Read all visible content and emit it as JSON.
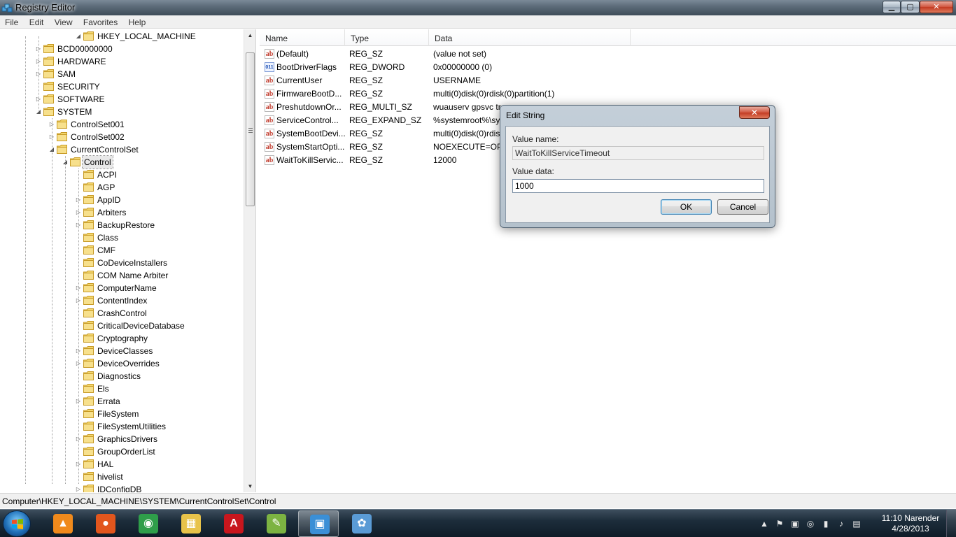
{
  "window": {
    "title": "Registry Editor"
  },
  "menu": [
    "File",
    "Edit",
    "View",
    "Favorites",
    "Help"
  ],
  "tree": {
    "items": [
      {
        "label": "HKEY_LOCAL_MACHINE",
        "expanded": true
      },
      {
        "label": "BCD00000000"
      },
      {
        "label": "HARDWARE"
      },
      {
        "label": "SAM"
      },
      {
        "label": "SECURITY"
      },
      {
        "label": "SOFTWARE"
      },
      {
        "label": "SYSTEM",
        "expanded": true
      },
      {
        "label": "ControlSet001"
      },
      {
        "label": "ControlSet002"
      },
      {
        "label": "CurrentControlSet",
        "expanded": true
      },
      {
        "label": "Control",
        "expanded": true,
        "selected": true
      },
      {
        "label": "ACPI"
      },
      {
        "label": "AGP"
      },
      {
        "label": "AppID"
      },
      {
        "label": "Arbiters"
      },
      {
        "label": "BackupRestore"
      },
      {
        "label": "Class"
      },
      {
        "label": "CMF"
      },
      {
        "label": "CoDeviceInstallers"
      },
      {
        "label": "COM Name Arbiter"
      },
      {
        "label": "ComputerName"
      },
      {
        "label": "ContentIndex"
      },
      {
        "label": "CrashControl"
      },
      {
        "label": "CriticalDeviceDatabase"
      },
      {
        "label": "Cryptography"
      },
      {
        "label": "DeviceClasses"
      },
      {
        "label": "DeviceOverrides"
      },
      {
        "label": "Diagnostics"
      },
      {
        "label": "Els"
      },
      {
        "label": "Errata"
      },
      {
        "label": "FileSystem"
      },
      {
        "label": "FileSystemUtilities"
      },
      {
        "label": "GraphicsDrivers"
      },
      {
        "label": "GroupOrderList"
      },
      {
        "label": "HAL"
      },
      {
        "label": "hivelist"
      },
      {
        "label": "IDConfigDB"
      }
    ]
  },
  "list": {
    "columns": [
      "Name",
      "Type",
      "Data"
    ],
    "rows": [
      {
        "icon": "string-value-icon",
        "name": "(Default)",
        "type": "REG_SZ",
        "data": "(value not set)"
      },
      {
        "icon": "binary-value-icon",
        "name": "BootDriverFlags",
        "type": "REG_DWORD",
        "data": "0x00000000 (0)"
      },
      {
        "icon": "string-value-icon",
        "name": "CurrentUser",
        "type": "REG_SZ",
        "data": "USERNAME"
      },
      {
        "icon": "string-value-icon",
        "name": "FirmwareBootD...",
        "type": "REG_SZ",
        "data": "multi(0)disk(0)rdisk(0)partition(1)"
      },
      {
        "icon": "string-value-icon",
        "name": "PreshutdownOr...",
        "type": "REG_MULTI_SZ",
        "data": "wuauserv gpsvc tr"
      },
      {
        "icon": "string-value-icon",
        "name": "ServiceControl...",
        "type": "REG_EXPAND_SZ",
        "data": "%systemroot%\\sy"
      },
      {
        "icon": "string-value-icon",
        "name": "SystemBootDevi...",
        "type": "REG_SZ",
        "data": "multi(0)disk(0)rdis"
      },
      {
        "icon": "string-value-icon",
        "name": "SystemStartOpti...",
        "type": "REG_SZ",
        "data": " NOEXECUTE=OPT"
      },
      {
        "icon": "string-value-icon",
        "name": "WaitToKillServic...",
        "type": "REG_SZ",
        "data": "12000"
      }
    ]
  },
  "statusbar": {
    "path": "Computer\\HKEY_LOCAL_MACHINE\\SYSTEM\\CurrentControlSet\\Control"
  },
  "dialog": {
    "title": "Edit String",
    "close_glyph": "✕",
    "value_name_label": "Value name:",
    "value_name": "WaitToKillServiceTimeout",
    "value_data_label": "Value data:",
    "value_data": "1000",
    "ok_label": "OK",
    "cancel_label": "Cancel"
  },
  "taskbar": {
    "apps": [
      {
        "name": "vlc-icon",
        "color": "#f08a1c"
      },
      {
        "name": "firefox-icon",
        "color": "#e2561d"
      },
      {
        "name": "chrome-icon",
        "color": "#2f9e4a"
      },
      {
        "name": "explorer-icon",
        "color": "#e8c34a"
      },
      {
        "name": "acrobat-icon",
        "color": "#c8161d"
      },
      {
        "name": "notepad-plus-icon",
        "color": "#7cb342"
      },
      {
        "name": "regedit-icon",
        "color": "#3a8fd6",
        "active": true
      },
      {
        "name": "paint-icon",
        "color": "#5a9bd5"
      }
    ],
    "clock": {
      "time": "11:10 Narender",
      "date": "4/28/2013"
    }
  },
  "colors": {
    "accent": "#3c7fb1",
    "close_red": "#c23a22",
    "taskbar": "#1d2d3b"
  }
}
